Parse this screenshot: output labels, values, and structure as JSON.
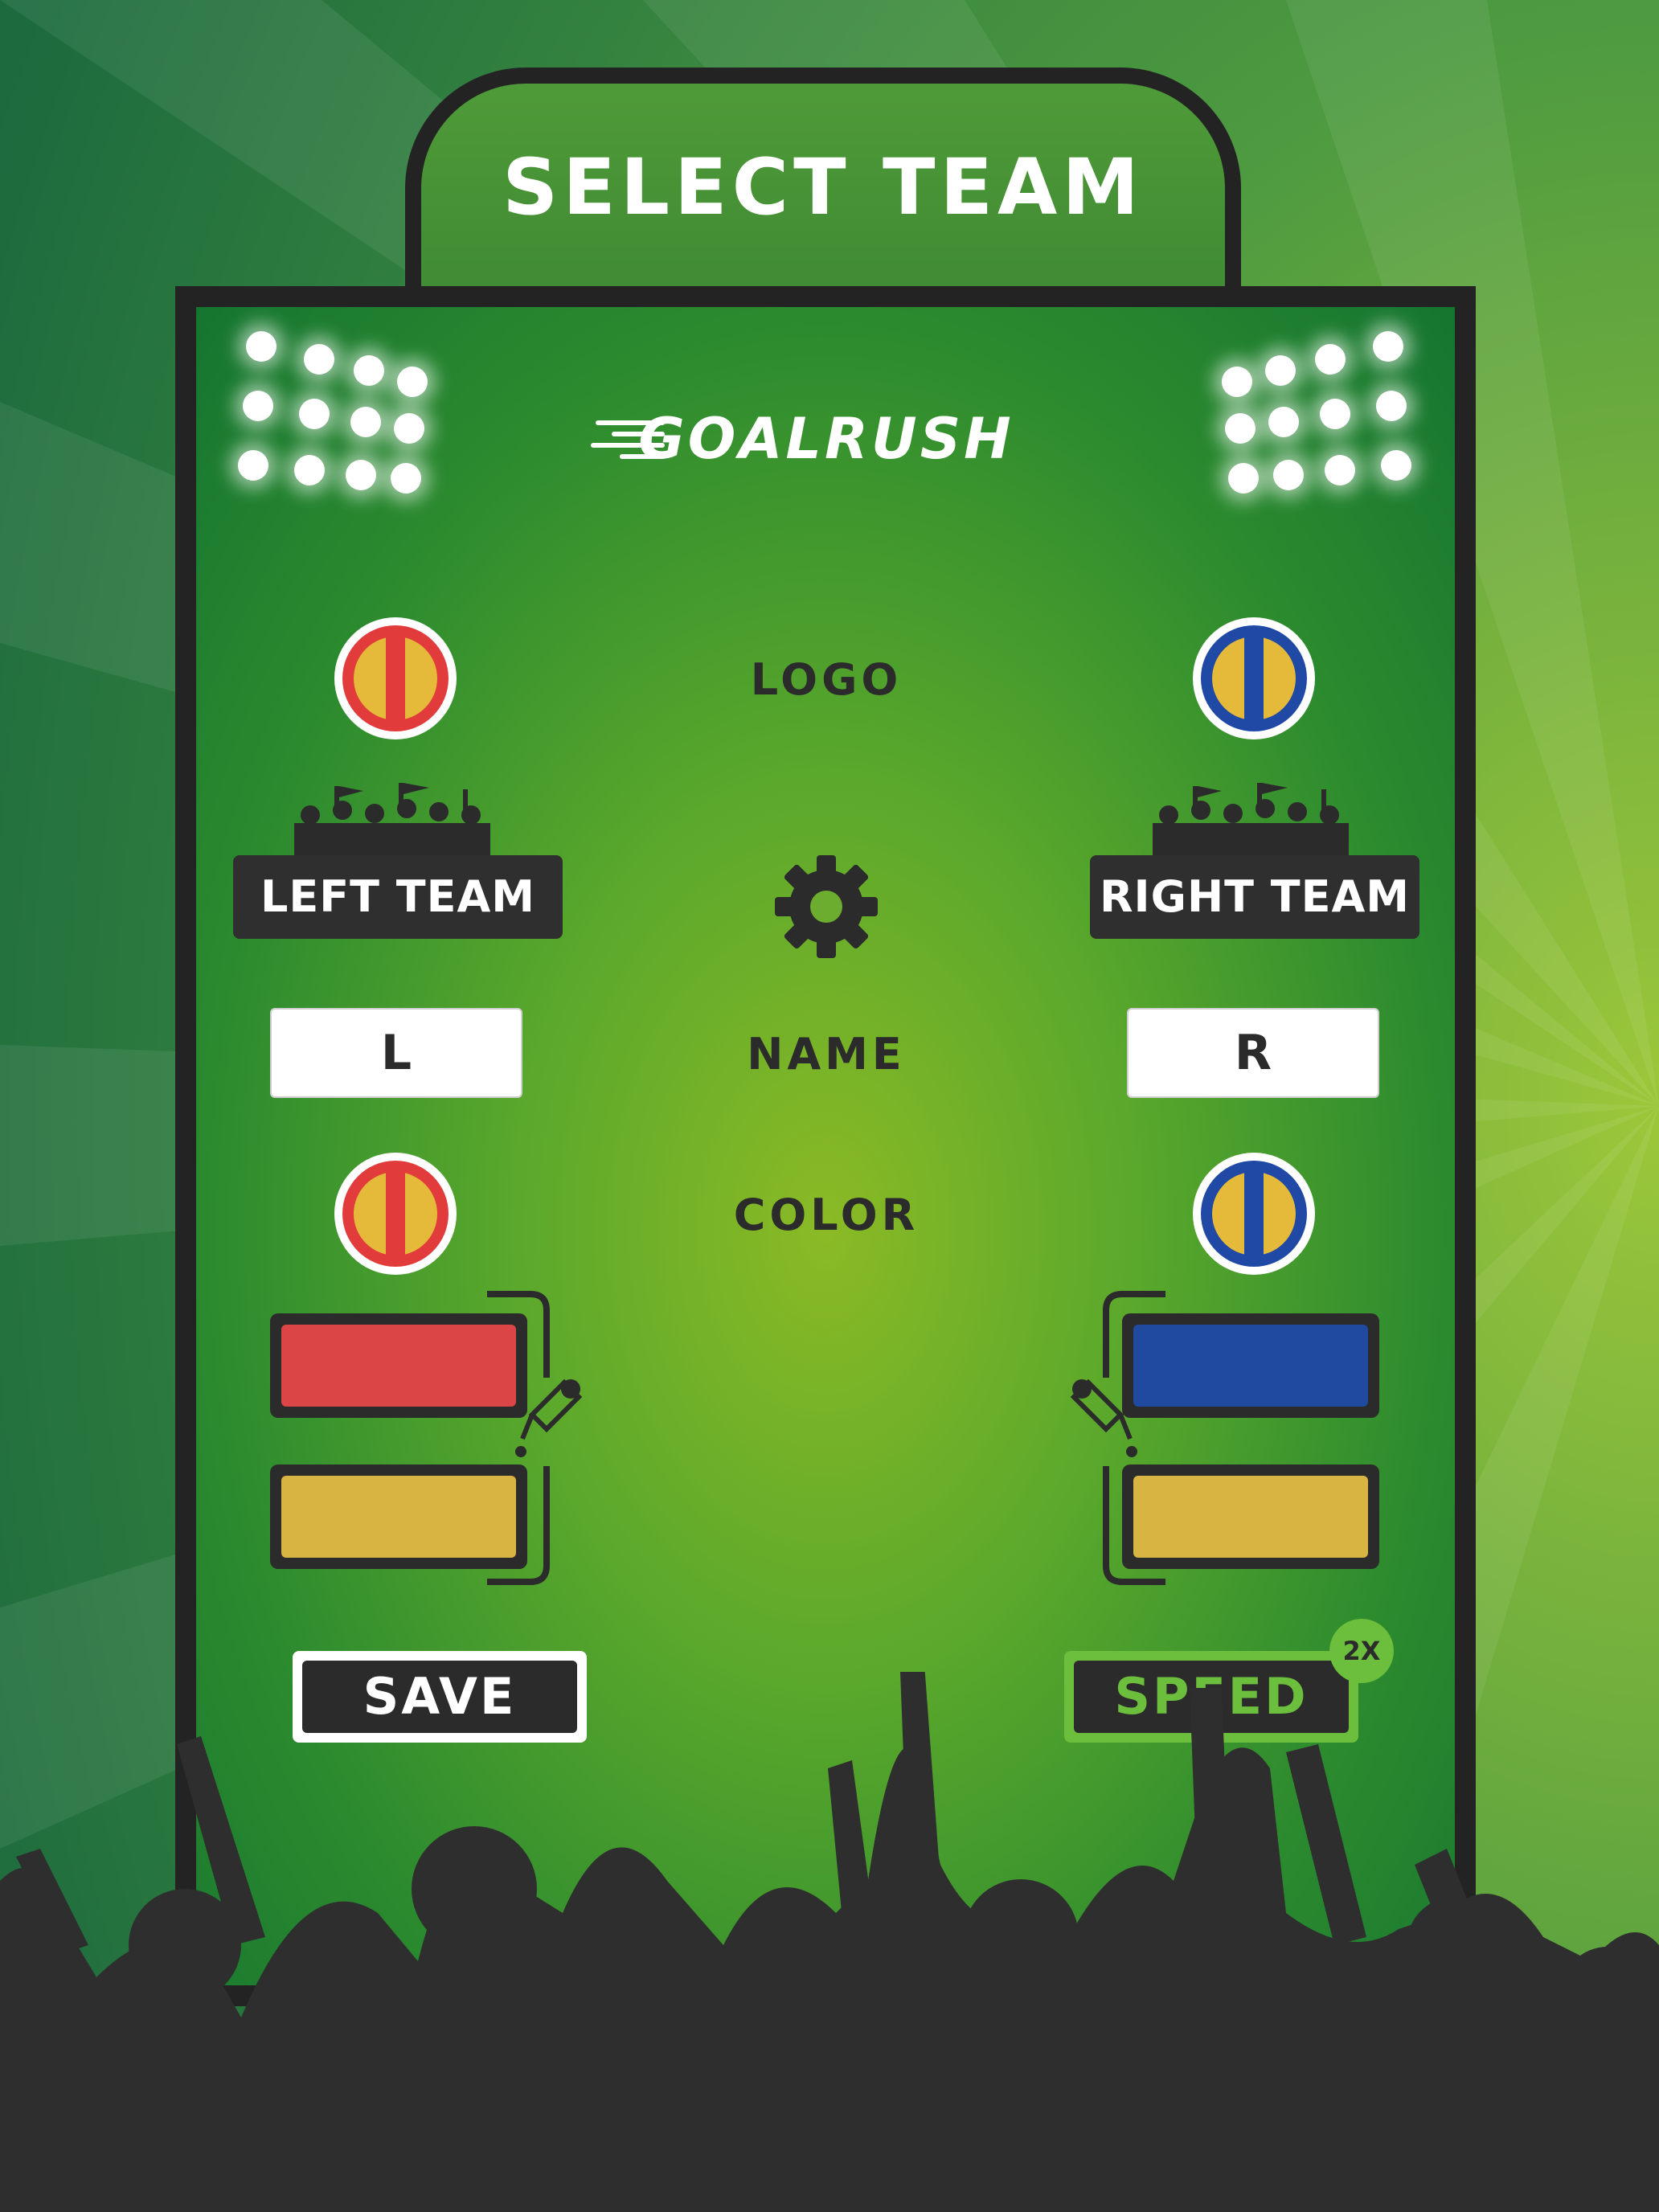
{
  "header": {
    "title": "SELECT TEAM"
  },
  "brand": {
    "logo_text": "GOALRUSH"
  },
  "labels": {
    "logo": "LOGO",
    "name": "NAME",
    "color": "COLOR"
  },
  "left_team": {
    "plate_label": "LEFT TEAM",
    "name_value": "L",
    "badge_primary": "#e23b3b",
    "badge_secondary": "#e5b93a",
    "color_primary": "#dc4545",
    "color_secondary": "#d8b442"
  },
  "right_team": {
    "plate_label": "RIGHT TEAM",
    "name_value": "R",
    "badge_primary": "#1f49a5",
    "badge_secondary": "#e5b93a",
    "color_primary": "#1f4aa0",
    "color_secondary": "#d8b442"
  },
  "buttons": {
    "save": "SAVE",
    "speed": "SPEED",
    "speed_multiplier": "2X"
  },
  "icons": {
    "settings": "gear-icon",
    "picker": "eyedropper-icon"
  },
  "colors": {
    "accent": "#6cbf3c",
    "panel_dark": "#232323"
  }
}
